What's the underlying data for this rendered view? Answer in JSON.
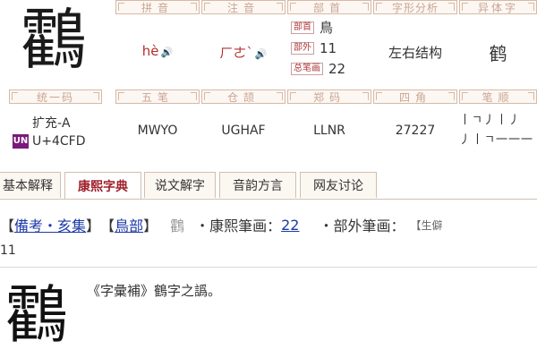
{
  "char": "鸖",
  "headers": {
    "pinyin": "拼音",
    "zhuyin": "注音",
    "bushou": "部首",
    "zixing": "字形分析",
    "yitizi": "异体字",
    "tongyima": "统一码",
    "wubi": "五笔",
    "cangjie": "仓颉",
    "zhengma": "郑码",
    "sijiao": "四角",
    "bishun": "笔顺"
  },
  "values": {
    "pinyin": "hè",
    "zhuyin": "ㄏㄜˋ",
    "bushou_tag": "部首",
    "bushou": "鳥",
    "buwai_tag": "部外",
    "buwai": "11",
    "zongbihua_tag": "总笔画",
    "zongbihua": "22",
    "zixing": "左右结构",
    "yitizi": "鹤",
    "unicode_block": "扩充-A",
    "unicode_logo": "UN",
    "unicode": "U+4CFD",
    "wubi": "MWYO",
    "cangjie": "UGHAF",
    "zhengma": "LLNR",
    "sijiao": "27227",
    "bishun_line1": "丨ㄱ丿丨丿",
    "bishun_line2": "丿丨ㄱ一一一"
  },
  "icons": {
    "speaker": "speaker-icon"
  },
  "tabs": [
    "基本解释",
    "康熙字典",
    "说文解字",
    "音韵方言",
    "网友讨论"
  ],
  "active_tab": 1,
  "kangxi": {
    "open1": "【",
    "ref_link": "備考・亥集",
    "close1": "】",
    "open2": "【",
    "bu_link": "鳥部",
    "close2": "】",
    "char_small": "鸖",
    "label1": "・康熙筆画：",
    "bihua_link": "22",
    "label2": "・部外筆画：",
    "truncated_open": "【",
    "truncated_text": "生僻",
    "line2": "11",
    "note": "《字彙補》鶴字之譌。"
  },
  "colors": {
    "accent_red": "#a0202a",
    "link_blue": "#1c3aa8",
    "header_border": "#d7b9a6"
  }
}
